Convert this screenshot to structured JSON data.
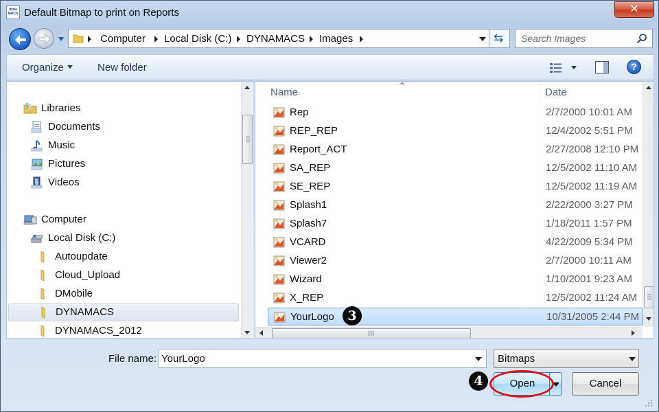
{
  "window": {
    "title": "Default Bitmap to print on Reports",
    "app_icon_text_top": "dyna",
    "app_icon_text_bottom": "MACS",
    "close_glyph": "✕"
  },
  "address": {
    "crumbs": [
      "Computer",
      "Local Disk (C:)",
      "DYNAMACS",
      "Images"
    ]
  },
  "search": {
    "placeholder": "Search Images"
  },
  "toolbar": {
    "organize_label": "Organize",
    "new_folder_label": "New folder",
    "help_glyph": "?"
  },
  "nav": {
    "items": [
      {
        "label": "Libraries",
        "icon": "libraries-icon"
      },
      {
        "label": "Documents",
        "icon": "documents-icon"
      },
      {
        "label": "Music",
        "icon": "music-icon"
      },
      {
        "label": "Pictures",
        "icon": "pictures-icon"
      },
      {
        "label": "Videos",
        "icon": "videos-icon"
      },
      {
        "label": "Computer",
        "icon": "computer-icon"
      },
      {
        "label": "Local Disk (C:)",
        "icon": "drive-icon"
      },
      {
        "label": "Autoupdate",
        "icon": "folder-icon"
      },
      {
        "label": "Cloud_Upload",
        "icon": "folder-icon"
      },
      {
        "label": "DMobile",
        "icon": "folder-icon"
      },
      {
        "label": "DYNAMACS",
        "icon": "folder-icon",
        "selected": true
      },
      {
        "label": "DYNAMACS_2012",
        "icon": "folder-icon"
      }
    ]
  },
  "files": {
    "columns": {
      "name": "Name",
      "date": "Date"
    },
    "rows": [
      {
        "name": "Rep",
        "date": "2/7/2000 10:01 AM"
      },
      {
        "name": "REP_REP",
        "date": "12/4/2002 5:51 PM"
      },
      {
        "name": "Report_ACT",
        "date": "2/27/2008 12:10 PM"
      },
      {
        "name": "SA_REP",
        "date": "12/5/2002 11:10 AM"
      },
      {
        "name": "SE_REP",
        "date": "12/5/2002 11:19 AM"
      },
      {
        "name": "Splash1",
        "date": "2/22/2000 3:27 PM"
      },
      {
        "name": "Splash7",
        "date": "1/18/2011 1:57 PM"
      },
      {
        "name": "VCARD",
        "date": "4/22/2009 5:34 PM"
      },
      {
        "name": "Viewer2",
        "date": "2/7/2000 10:11 AM"
      },
      {
        "name": "Wizard",
        "date": "1/10/2001 9:23 AM"
      },
      {
        "name": "X_REP",
        "date": "12/5/2002 11:24 AM"
      },
      {
        "name": "YourLogo",
        "date": "10/31/2005 2:44 PM",
        "selected": true
      }
    ]
  },
  "callouts": {
    "step3": "3",
    "step4": "4"
  },
  "bottom": {
    "filename_label": "File name:",
    "filename_value": "YourLogo",
    "filetype_value": "Bitmaps",
    "open_label": "Open",
    "cancel_label": "Cancel"
  },
  "colors": {
    "selection_fill": "#c1dcfc",
    "selection_border": "#7da2ce",
    "highlight_ring": "#d8141c"
  }
}
